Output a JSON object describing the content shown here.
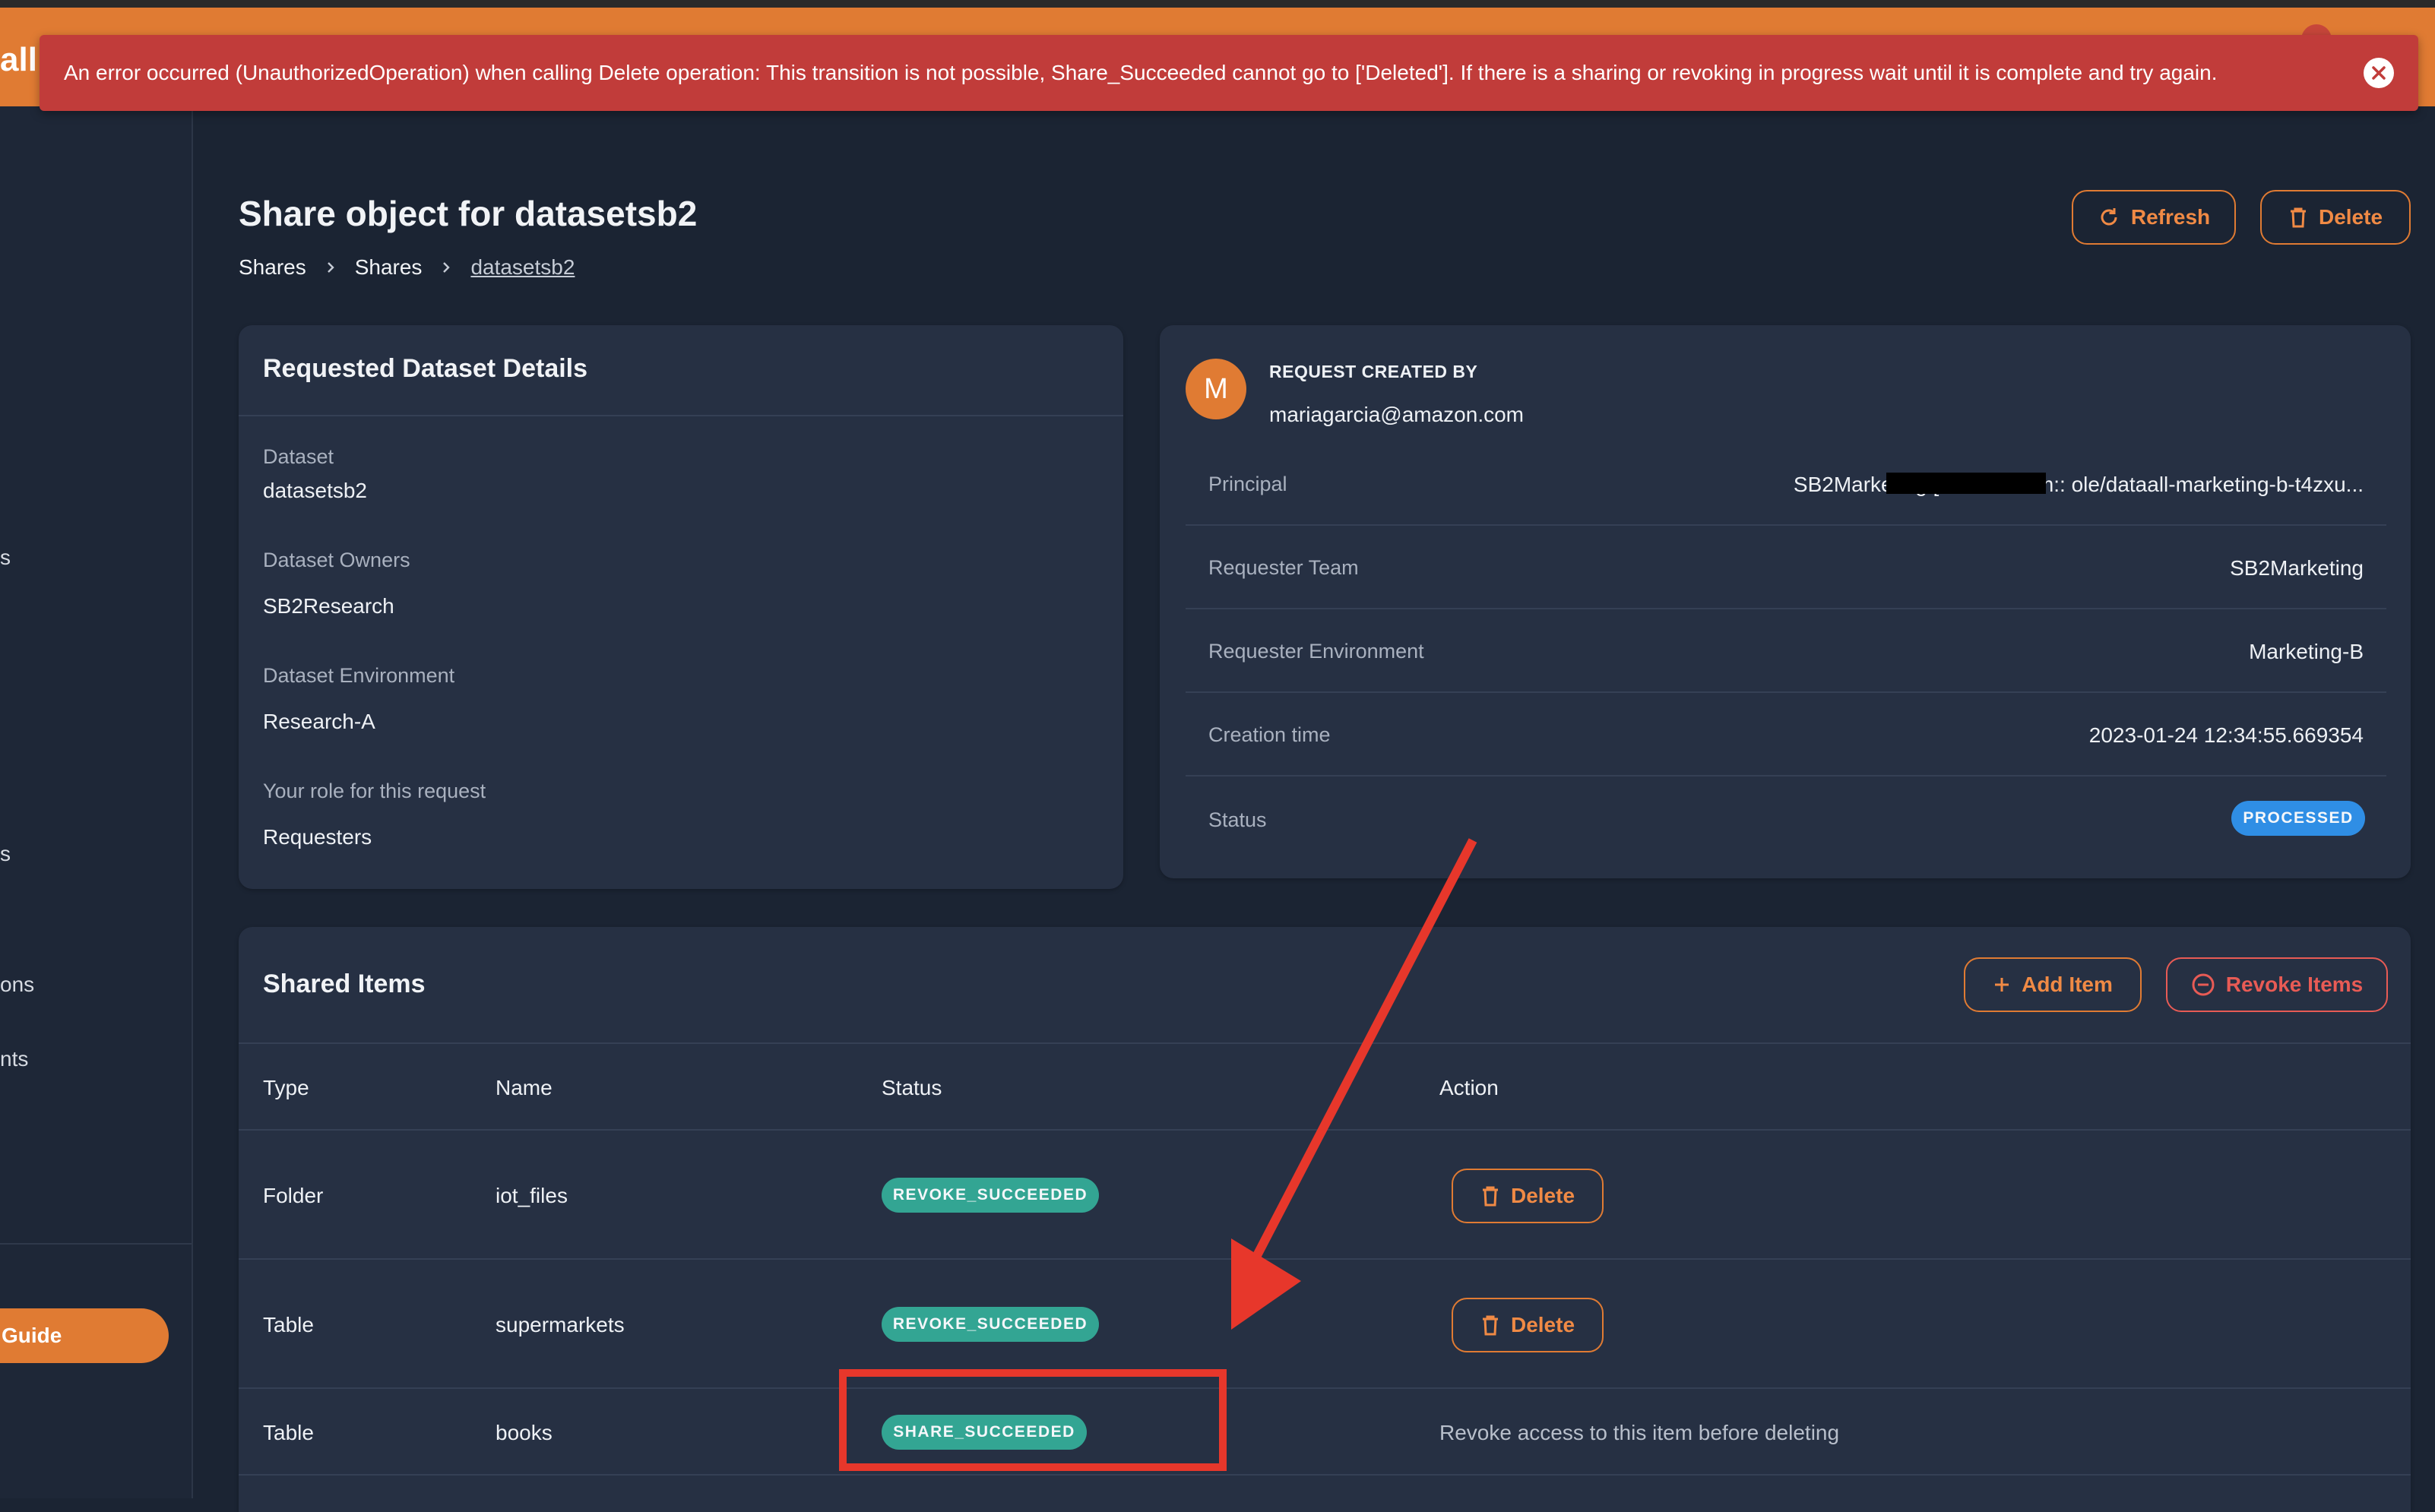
{
  "app": {
    "logo": "all"
  },
  "sidebar": {
    "items": [
      {
        "label": "s"
      },
      {
        "label": "s"
      },
      {
        "label": "ons"
      },
      {
        "label": "nts"
      }
    ],
    "guide_label": "Guide"
  },
  "error_banner": {
    "message": "An error occurred (UnauthorizedOperation) when calling Delete operation: This transition is not possible, Share_Succeeded cannot go to ['Deleted']. If there is a sharing or revoking in progress wait until it is complete and try again."
  },
  "page": {
    "title": "Share object for datasetsb2",
    "breadcrumb": [
      "Shares",
      "Shares",
      "datasetsb2"
    ],
    "refresh_label": "Refresh",
    "delete_label": "Delete"
  },
  "dataset_details": {
    "title": "Requested Dataset Details",
    "fields": [
      {
        "label": "Dataset",
        "value": "datasetsb2"
      },
      {
        "label": "Dataset Owners",
        "value": "SB2Research"
      },
      {
        "label": "Dataset Environment",
        "value": "Research-A"
      },
      {
        "label": "Your role for this request",
        "value": "Requesters"
      }
    ]
  },
  "request": {
    "avatar_letter": "M",
    "created_by_label": "REQUEST CREATED BY",
    "created_by_email": "mariagarcia@amazon.com",
    "fields": [
      {
        "label": "Principal",
        "value": "SB2Marketing [arn:aws:iam::                                  ole/dataall-marketing-b-t4zxu..."
      },
      {
        "label": "Requester Team",
        "value": "SB2Marketing"
      },
      {
        "label": "Requester Environment",
        "value": "Marketing-B"
      },
      {
        "label": "Creation time",
        "value": "2023-01-24 12:34:55.669354"
      },
      {
        "label": "Status",
        "value": "PROCESSED"
      }
    ]
  },
  "shared_items": {
    "title": "Shared Items",
    "add_label": "Add Item",
    "revoke_label": "Revoke Items",
    "columns": [
      "Type",
      "Name",
      "Status",
      "Action"
    ],
    "rows": [
      {
        "type": "Folder",
        "name": "iot_files",
        "status": "REVOKE_SUCCEEDED",
        "action": "Delete"
      },
      {
        "type": "Table",
        "name": "supermarkets",
        "status": "REVOKE_SUCCEEDED",
        "action": "Delete"
      },
      {
        "type": "Table",
        "name": "books",
        "status": "SHARE_SUCCEEDED",
        "action": "Revoke access to this item before deleting"
      }
    ]
  },
  "colors": {
    "accent": "#e07b33",
    "error": "#c13c3a",
    "success_chip": "#33a593",
    "info_chip": "#2f8ee5",
    "annotation": "#e7372b"
  }
}
